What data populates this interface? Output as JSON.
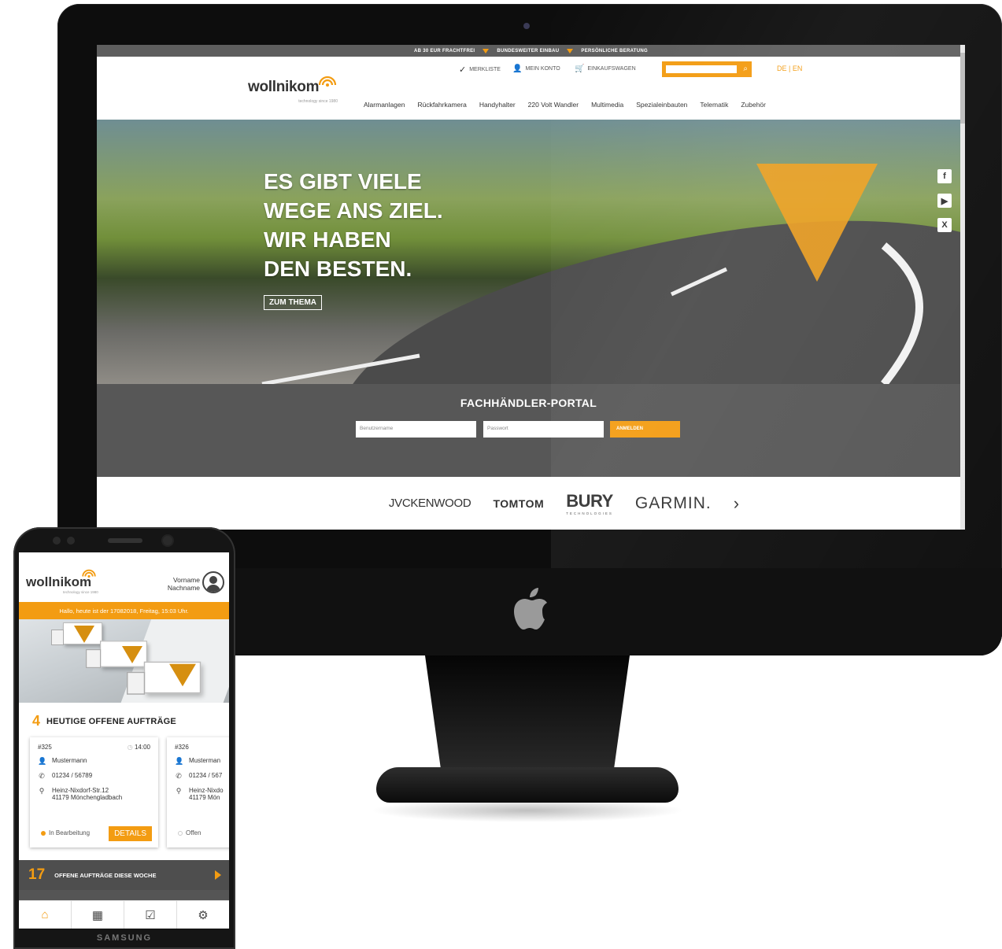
{
  "desktop": {
    "topbar": [
      "AB 30 EUR FRACHTFREI",
      "BUNDESWEITER EINBAU",
      "PERSÖNLICHE BERATUNG"
    ],
    "utility": {
      "wishlist": "MERKLISTE",
      "account": "MEIN KONTO",
      "cart": "EINKAUFSWAGEN"
    },
    "lang": "DE | EN",
    "logo": {
      "word": "wollnikom",
      "tagline": "technology since 1980"
    },
    "nav": [
      "Alarmanlagen",
      "Rückfahrkamera",
      "Handyhalter",
      "220 Volt Wandler",
      "Multimedia",
      "Spezialeinbauten",
      "Telematik",
      "Zubehör"
    ],
    "hero": {
      "headline_1": "ES GIBT VIELE",
      "headline_2": "WEGE ANS ZIEL.",
      "headline_3": "WIR HABEN",
      "headline_4": "DEN BESTEN.",
      "button": "ZUM THEMA"
    },
    "portal": {
      "title": "FACHHÄNDLER-PORTAL",
      "username_placeholder": "Benutzername",
      "password_placeholder": "Passwort",
      "login": "ANMELDEN"
    },
    "brands": [
      "JVCKENWOOD",
      "TOMTOM",
      "BURY",
      "TECHNOLOGIES",
      "GARMIN."
    ],
    "accent_color": "#f39c12"
  },
  "phone": {
    "logo": {
      "word": "wollnikom",
      "tagline": "technology since 1980"
    },
    "user": {
      "first": "Vorname",
      "last": "Nachname"
    },
    "greeting": "Hallo, heute ist der 17082018, Freitag, 15:03 Uhr.",
    "today": {
      "count": "4",
      "label": "HEUTIGE OFFENE AUFTRÄGE"
    },
    "orders": [
      {
        "id": "#325",
        "time": "14:00",
        "name": "Mustermann",
        "phone": "01234 / 56789",
        "street": "Heinz-Nixdorf-Str.12",
        "city": "41179 Mönchengladbach",
        "status": "In Bearbeitung",
        "details": "DETAILS"
      },
      {
        "id": "#326",
        "name": "Musterman",
        "phone": "01234 / 567",
        "street": "Heinz-Nixdo",
        "city": "41179 Mön",
        "status": "Offen"
      }
    ],
    "week": {
      "count": "17",
      "label": "OFFENE AUFTRÄGE DIESE WOCHE"
    },
    "brand": "SAMSUNG"
  }
}
